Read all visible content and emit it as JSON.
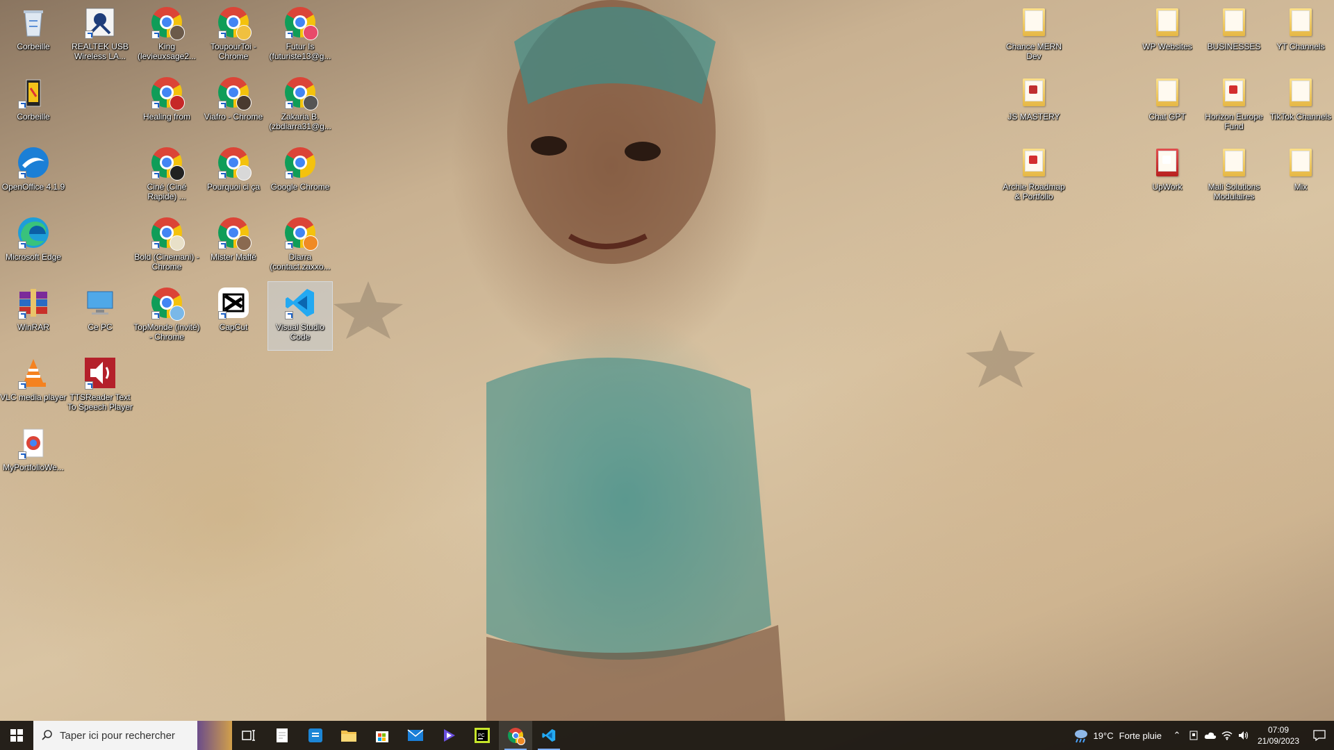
{
  "desktop": {
    "icons": [
      {
        "label": "Corbeille",
        "icon": "recycle-bin-icon"
      },
      {
        "label": "REALTEK USB Wireless LA...",
        "icon": "realtek-wireless-icon"
      },
      {
        "label": "King (levieuxsage2...",
        "icon": "chrome-profile-icon"
      },
      {
        "label": "ToupourToi - Chrome",
        "icon": "chrome-profile-icon"
      },
      {
        "label": "Futur Is (futuriste13@g...",
        "icon": "chrome-profile-icon"
      },
      {
        "label": "Corbeille",
        "icon": "recycle-bin-icon"
      },
      {
        "label": "Healing from",
        "icon": "chrome-profile-icon"
      },
      {
        "label": "Viafro - Chrome",
        "icon": "chrome-profile-icon"
      },
      {
        "label": "Zakaria B. (zbdiarra31@g...",
        "icon": "chrome-profile-icon"
      },
      {
        "label": "OpenOffice 4.1.9",
        "icon": "openoffice-icon"
      },
      {
        "label": "Ciné (Ciné Rapide) ...",
        "icon": "chrome-profile-icon"
      },
      {
        "label": "Pourquoi ci ça",
        "icon": "chrome-profile-icon"
      },
      {
        "label": "Google Chrome",
        "icon": "chrome-icon"
      },
      {
        "label": "Microsoft Edge",
        "icon": "edge-icon"
      },
      {
        "label": "Bold (Cinemani) - Chrome",
        "icon": "chrome-profile-icon"
      },
      {
        "label": "Mister Maffé",
        "icon": "chrome-profile-icon"
      },
      {
        "label": "Diarra (contact.zaxxo...",
        "icon": "chrome-profile-icon"
      },
      {
        "label": "WinRAR",
        "icon": "winrar-icon"
      },
      {
        "label": "Ce PC",
        "icon": "this-pc-icon"
      },
      {
        "label": "TopMonde (invité) - Chrome",
        "icon": "chrome-profile-icon"
      },
      {
        "label": "CapCut",
        "icon": "capcut-icon"
      },
      {
        "label": "Visual Studio Code",
        "icon": "vscode-icon"
      },
      {
        "label": "VLC media player",
        "icon": "vlc-icon"
      },
      {
        "label": "TTSReader Text To Speech Player",
        "icon": "ttsreader-icon"
      },
      {
        "label": "MyPortfolioWe...",
        "icon": "chrome-app-icon"
      },
      {
        "label": "Chance MERN Dev",
        "icon": "folder-icon"
      },
      {
        "label": "WP Websites",
        "icon": "folder-icon"
      },
      {
        "label": "BUSINESSES",
        "icon": "folder-icon"
      },
      {
        "label": "YT Channels",
        "icon": "folder-icon"
      },
      {
        "label": "JS MASTERY",
        "icon": "folder-icon"
      },
      {
        "label": "Chat GPT",
        "icon": "folder-icon"
      },
      {
        "label": "Horizon Europe Fund",
        "icon": "folder-icon"
      },
      {
        "label": "TikTok Channels",
        "icon": "folder-icon"
      },
      {
        "label": "Archie Roadmap & Portfolio",
        "icon": "folder-icon"
      },
      {
        "label": "UpWork",
        "icon": "folder-icon"
      },
      {
        "label": "Mali Solutions Modulaires",
        "icon": "folder-icon"
      },
      {
        "label": "Mix",
        "icon": "folder-icon"
      }
    ]
  },
  "taskbar": {
    "search_placeholder": "Taper ici pour rechercher",
    "weather_temp": "19°C",
    "weather_desc": "Forte pluie",
    "time": "07:09",
    "date": "21/09/2023"
  },
  "colors": {
    "chrome_red": "#db4437",
    "chrome_yellow": "#f4c20d",
    "chrome_green": "#0f9d58",
    "chrome_blue": "#4285f4",
    "vscode_blue": "#23a9f2",
    "taskbar_bg": "#16120e"
  }
}
